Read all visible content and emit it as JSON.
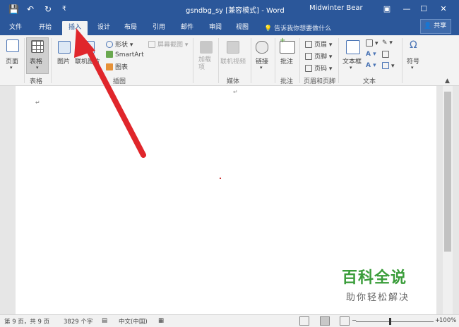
{
  "titlebar": {
    "title": "gsndbg_sy [兼容模式] - Word",
    "user": "Midwinter Bear",
    "save_icon": "💾",
    "undo": "↶",
    "redo": "↻",
    "qa_more": "₹",
    "ribbon_display": "▣",
    "minimize": "—",
    "maximize": "☐",
    "close": "✕"
  },
  "tabs": [
    "文件",
    "开始",
    "插入",
    "设计",
    "布局",
    "引用",
    "邮件",
    "审阅",
    "视图"
  ],
  "active_tab": "插入",
  "tell_me": "告诉我你想要做什么",
  "share": "共享",
  "ribbon": {
    "page_label": "页面",
    "table_label": "表格",
    "group_table": "表格",
    "picture": "图片",
    "online_picture": "联机图片",
    "shapes": "形状",
    "smartart": "SmartArt",
    "chart": "图表",
    "screenshot": "屏幕截图",
    "group_illustrations": "插图",
    "addins": "加载项",
    "online_video": "联机视频",
    "group_media": "媒体",
    "link": "链接",
    "comment": "批注",
    "group_comment": "批注",
    "header": "页眉",
    "footer": "页脚",
    "page_number": "页码",
    "group_header_footer": "页眉和页脚",
    "textbox": "文本框",
    "group_text": "文本",
    "symbol": "符号"
  },
  "document": {
    "para_mark_1": "↵",
    "para_mark_2": "↵"
  },
  "watermark": {
    "line1": "百科全说",
    "line2": "助你轻松解决"
  },
  "status": {
    "page": "第 9 页，共 9 页",
    "words": "3829 个字",
    "language": "中文(中国)",
    "zoom_minus": "−",
    "zoom_plus": "+",
    "zoom": "100%"
  },
  "colors": {
    "accent": "#2b579a",
    "arrow": "#e0262b",
    "watermark_green": "#3a9d3a"
  }
}
